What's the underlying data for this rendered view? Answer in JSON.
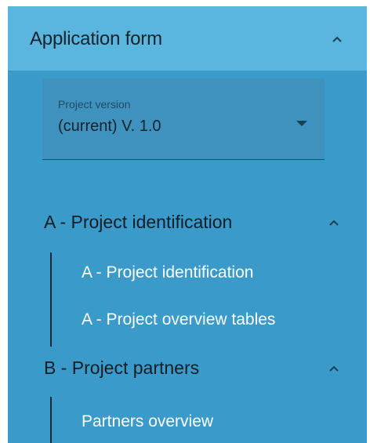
{
  "header": {
    "title": "Application form",
    "chevron_icon": "chevron-up-icon"
  },
  "version_select": {
    "label": "Project version",
    "value": "(current) V. 1.0",
    "arrow_icon": "dropdown-arrow-icon"
  },
  "sections": [
    {
      "title": "A - Project identification",
      "expanded": true,
      "items": [
        {
          "label": "A - Project identification"
        },
        {
          "label": "A - Project overview tables"
        }
      ]
    },
    {
      "title": "B - Project partners",
      "expanded": true,
      "items": [
        {
          "label": "Partners overview"
        }
      ]
    }
  ],
  "colors": {
    "panel_bg": "#3a9bcb",
    "header_bg": "#5ab6df",
    "select_bg": "#3f92be",
    "sub_item_text": "#ffffff",
    "title_text": "#111d24"
  }
}
